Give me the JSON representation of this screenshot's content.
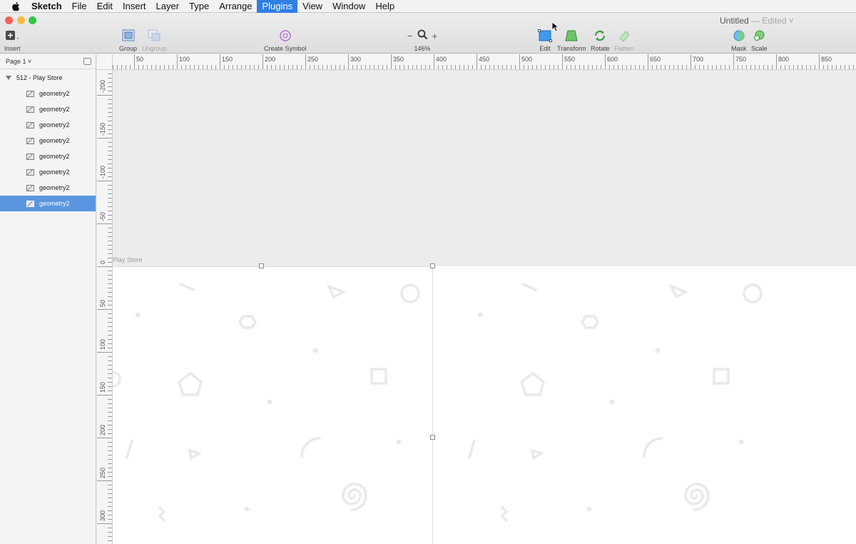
{
  "menubar": {
    "app_name": "Sketch",
    "items": [
      "File",
      "Edit",
      "Insert",
      "Layer",
      "Type",
      "Arrange",
      "Plugins",
      "View",
      "Window",
      "Help"
    ],
    "active_item": "Plugins",
    "apple_icon": "apple-logo-icon"
  },
  "window": {
    "title": "Untitled",
    "status": "— Edited ˅",
    "traffic_lights": {
      "close": "#fc5d57",
      "minimize": "#fdbc40",
      "zoom": "#33c748"
    }
  },
  "toolbar": {
    "insert": "Insert",
    "group": "Group",
    "ungroup": "Ungroup",
    "create_symbol": "Create Symbol",
    "zoom_out": "−",
    "zoom_in": "+",
    "zoom_level": "146%",
    "edit": "Edit",
    "transform": "Transform",
    "rotate": "Rotate",
    "flatten": "Flatten",
    "mask": "Mask",
    "scale": "Scale"
  },
  "sidebar": {
    "page": "Page 1 ˅",
    "artboard": "512 - Play Store",
    "layers": [
      {
        "name": "geometry2",
        "selected": false
      },
      {
        "name": "geometry2",
        "selected": false
      },
      {
        "name": "geometry2",
        "selected": false
      },
      {
        "name": "geometry2",
        "selected": false
      },
      {
        "name": "geometry2",
        "selected": false
      },
      {
        "name": "geometry2",
        "selected": false
      },
      {
        "name": "geometry2",
        "selected": false
      },
      {
        "name": "geometry2",
        "selected": true
      }
    ]
  },
  "rulers": {
    "horizontal": [
      "50",
      "100",
      "150",
      "200",
      "250",
      "300",
      "350",
      "400",
      "450",
      "500",
      "550",
      "600",
      "650",
      "700",
      "750",
      "800",
      "850"
    ],
    "vertical": [
      "-200",
      "-150",
      "-100",
      "-50",
      "0",
      "50",
      "100",
      "150",
      "200",
      "250",
      "300"
    ]
  },
  "canvas": {
    "artboard_label": "Play Store"
  },
  "colors": {
    "accent": "#2f7fe3",
    "selection": "#5a96e0",
    "pattern": "#e9e9e9"
  }
}
